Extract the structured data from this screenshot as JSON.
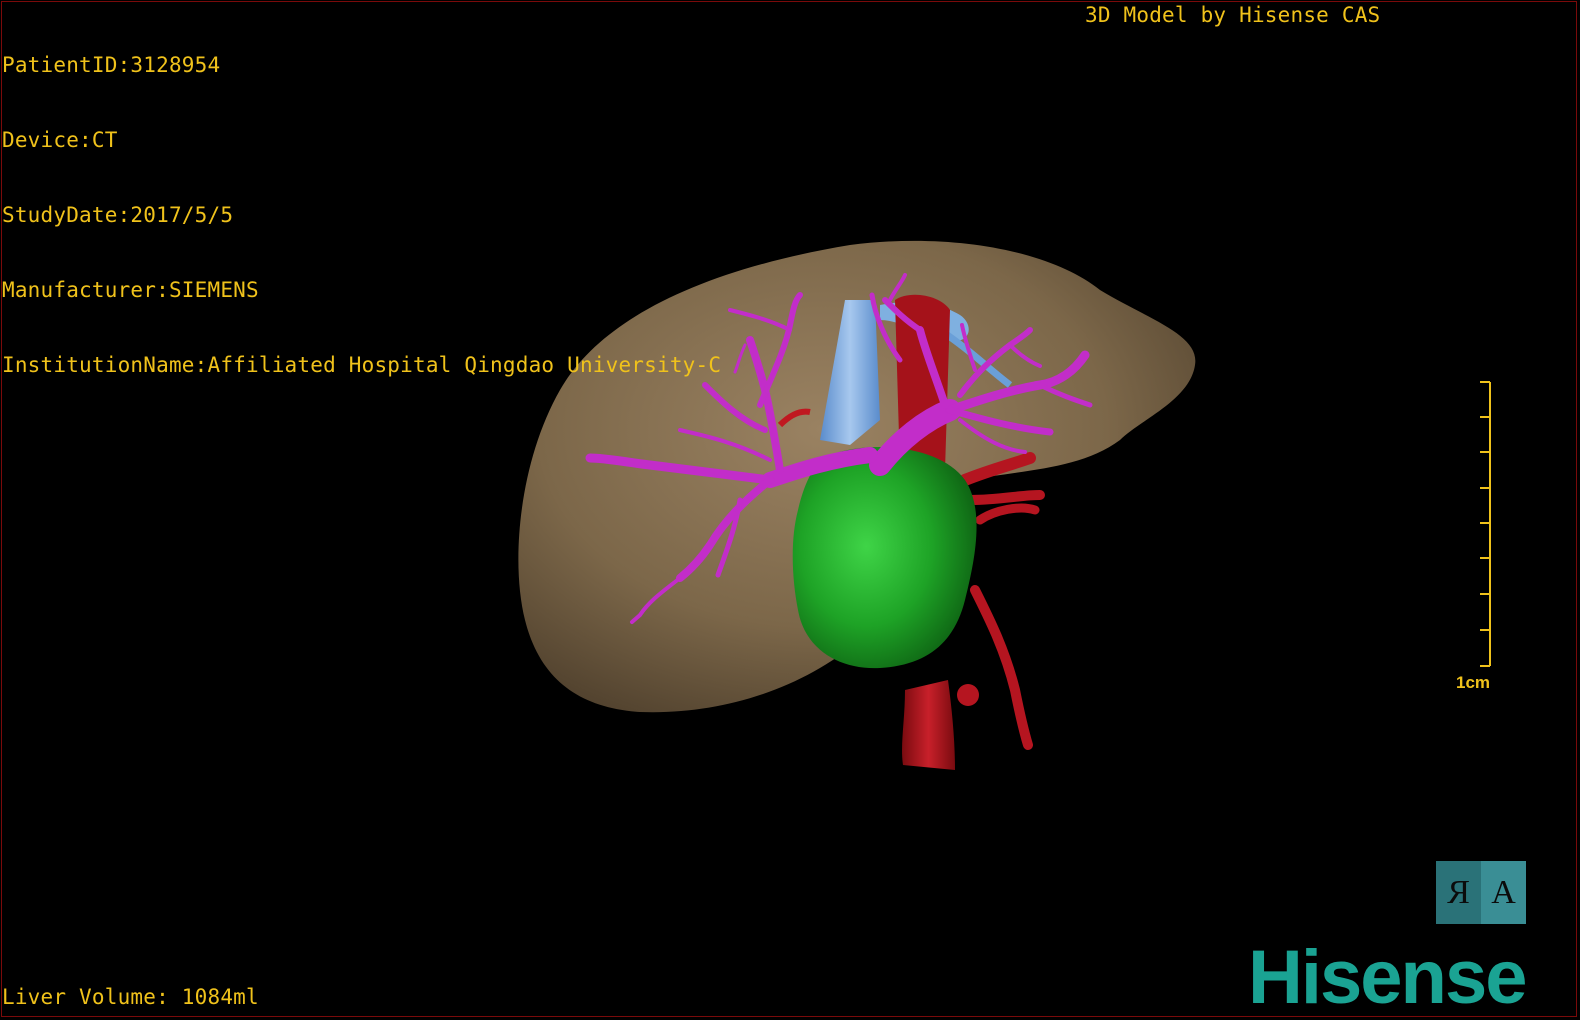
{
  "dicom": {
    "patient_id": "PatientID:3128954",
    "device": "Device:CT",
    "study_date": "StudyDate:2017/5/5",
    "manufacturer": "Manufacturer:SIEMENS",
    "institution": "InstitutionName:Affiliated Hospital Qingdao University-C"
  },
  "credit": "3D Model by Hisense CAS",
  "liver_volume": "Liver Volume: 1084ml",
  "scale": {
    "label": "1cm"
  },
  "orientation": {
    "left": "R",
    "right": "A"
  },
  "brand": "Hisense",
  "colors": {
    "overlay_text": "#f0c21b",
    "liver": "#8a7355",
    "portal_vein": "#c22dc9",
    "hepatic_vein": "#7fb0e0",
    "artery": "#b0121a",
    "tumor": "#1a9e22",
    "brand": "#1aa393"
  }
}
